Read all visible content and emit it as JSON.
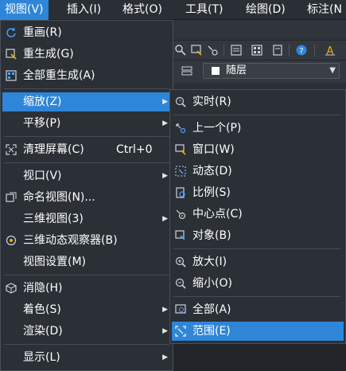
{
  "menubar": {
    "items": [
      {
        "label": "视图(V)"
      },
      {
        "label": "插入(I)"
      },
      {
        "label": "格式(O)"
      },
      {
        "label": "工具(T)"
      },
      {
        "label": "绘图(D)"
      },
      {
        "label": "标注(N"
      }
    ]
  },
  "toolbar": {
    "layer_value": "随层"
  },
  "view_menu": {
    "items": [
      {
        "label": "重画(R)",
        "icon": "redraw-icon"
      },
      {
        "label": "重生成(G)",
        "icon": "regen-icon"
      },
      {
        "label": "全部重生成(A)",
        "icon": "regen-all-icon"
      },
      {
        "label": "缩放(Z)",
        "submenu": true,
        "highlighted": true
      },
      {
        "label": "平移(P)",
        "submenu": true
      },
      {
        "label": "清理屏幕(C)",
        "shortcut": "Ctrl+0",
        "icon": "clean-screen-icon"
      },
      {
        "label": "视口(V)",
        "submenu": true
      },
      {
        "label": "命名视图(N)...",
        "icon": "named-view-icon"
      },
      {
        "label": "三维视图(3)",
        "submenu": true
      },
      {
        "label": "三维动态观察器(B)",
        "icon": "orbit-icon"
      },
      {
        "label": "视图设置(M)"
      },
      {
        "label": "消隐(H)",
        "icon": "hide-icon"
      },
      {
        "label": "着色(S)",
        "submenu": true
      },
      {
        "label": "渲染(D)",
        "submenu": true
      },
      {
        "label": "显示(L)",
        "submenu": true
      }
    ]
  },
  "zoom_menu": {
    "items": [
      {
        "label": "实时(R)",
        "icon": "zoom-realtime-icon"
      },
      {
        "label": "上一个(P)",
        "icon": "zoom-previous-icon"
      },
      {
        "label": "窗口(W)",
        "icon": "zoom-window-icon"
      },
      {
        "label": "动态(D)",
        "icon": "zoom-dynamic-icon"
      },
      {
        "label": "比例(S)",
        "icon": "zoom-scale-icon"
      },
      {
        "label": "中心点(C)",
        "icon": "zoom-center-icon"
      },
      {
        "label": "对象(B)",
        "icon": "zoom-object-icon"
      },
      {
        "label": "放大(I)",
        "icon": "zoom-in-icon"
      },
      {
        "label": "缩小(O)",
        "icon": "zoom-out-icon"
      },
      {
        "label": "全部(A)",
        "icon": "zoom-all-icon"
      },
      {
        "label": "范围(E)",
        "icon": "zoom-extents-icon",
        "highlighted": true
      }
    ]
  },
  "colors": {
    "accent": "#2f86d8",
    "menu_bg": "#2b2f36",
    "border": "#4a4f57"
  }
}
